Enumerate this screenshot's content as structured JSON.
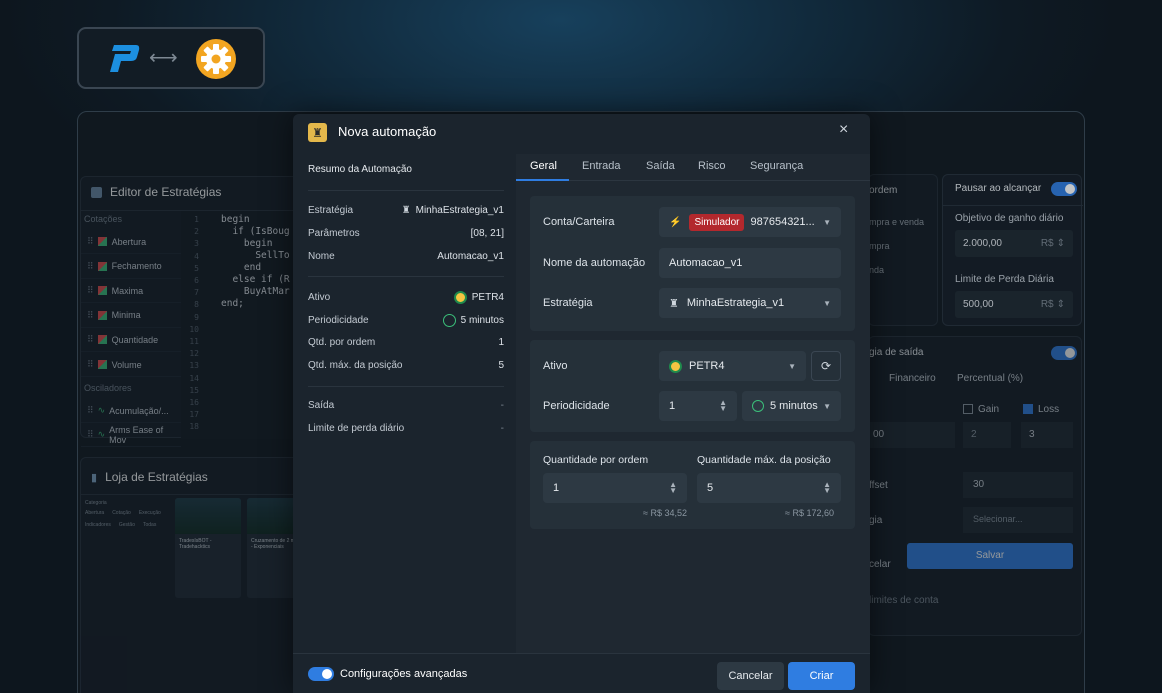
{
  "colors": {
    "accent": "#2f7de1",
    "badge_red": "#b3282d",
    "bg": "#0e1a24"
  },
  "logo": {
    "brand_icon": "profit-p-logo",
    "arrow_icon": "double-arrow-icon",
    "gear_icon": "gear-icon"
  },
  "editor": {
    "title": "Editor de Estratégias",
    "section_quotes": "Cotações",
    "items": [
      "Abertura",
      "Fechamento",
      "Maxima",
      "Minima",
      "Quantidade",
      "Volume"
    ],
    "section_osc": "Osciladores",
    "osc_items": [
      "Acumulação/...",
      "Arms Ease of Mov"
    ],
    "code_lines": [
      "begin",
      "  if (IsBoug",
      "    begin",
      "      SellTo",
      "    end",
      "  else if (R",
      "    BuyAtMar",
      "end;"
    ],
    "line_numbers": [
      "1",
      "2",
      "3",
      "4",
      "5",
      "6",
      "7",
      "8",
      "9",
      "10",
      "11",
      "12",
      "13",
      "14",
      "15",
      "16",
      "17",
      "18"
    ]
  },
  "store": {
    "title": "Loja de Estratégias",
    "category": "Categoria",
    "filters": [
      "Abertura",
      "Cotação",
      "Execução",
      "Indicadores",
      "Gestão",
      "Todas"
    ],
    "card1": "TradesIsBOT - Tradehacktics",
    "card2": "Cruzamento de 2 m - Exponenciais"
  },
  "right_panel": {
    "pause_label": "Pausar ao alcançar",
    "gain_goal_label": "Objetivo de ganho diário",
    "gain_goal_value": "2.000,00",
    "currency": "R$",
    "loss_limit_label": "Limite de Perda Diária",
    "loss_limit_value": "500,00",
    "order_label": "ordem",
    "order_opts": [
      "mpra e venda",
      "mpra",
      "nda"
    ],
    "exit_label": "gia de saída",
    "tab_fin": "Financeiro",
    "tab_pct": "Percentual (%)",
    "gain": "Gain",
    "loss": "Loss",
    "val_00": "00",
    "val_2": "2",
    "val_3": "3",
    "offset": "ffset",
    "offset_val": "30",
    "select_placeholder": "Selecionar...",
    "strategy_cut": "gia",
    "cancel_cut": "celar",
    "save": "Salvar",
    "bottom_text": "limites de conta"
  },
  "dialog": {
    "title": "Nova automação",
    "close": "×",
    "summary": {
      "title": "Resumo da Automação",
      "rows": [
        {
          "label": "Estratégia",
          "value": "MinhaEstrategia_v1"
        },
        {
          "label": "Parâmetros",
          "value": "[08, 21]"
        },
        {
          "label": "Nome",
          "value": "Automacao_v1"
        },
        {
          "label": "Ativo",
          "value": "PETR4"
        },
        {
          "label": "Periodicidade",
          "value": "5 minutos"
        },
        {
          "label": "Qtd. por ordem",
          "value": "1"
        },
        {
          "label": "Qtd. máx. da posição",
          "value": "5"
        },
        {
          "label": "Saída",
          "value": "-"
        },
        {
          "label": "Limite de perda diário",
          "value": "-"
        }
      ]
    },
    "tabs": [
      "Geral",
      "Entrada",
      "Saída",
      "Risco",
      "Segurança"
    ],
    "account_label": "Conta/Carteira",
    "account_badge": "Simulador",
    "account_value": "987654321...",
    "name_label": "Nome da automação",
    "name_value": "Automacao_v1",
    "strategy_label": "Estratégia",
    "strategy_value": "MinhaEstrategia_v1",
    "asset_label": "Ativo",
    "asset_value": "PETR4",
    "period_label": "Periodicidade",
    "period_value": "1",
    "period_unit": "5 minutos",
    "qty_label": "Quantidade por ordem",
    "qty_value": "1",
    "qty_est": "≈ R$ 34,52",
    "maxpos_label": "Quantidade máx. da posição",
    "maxpos_value": "5",
    "maxpos_est": "≈ R$ 172,60",
    "advanced": "Configurações avançadas",
    "cancel": "Cancelar",
    "create": "Criar"
  }
}
